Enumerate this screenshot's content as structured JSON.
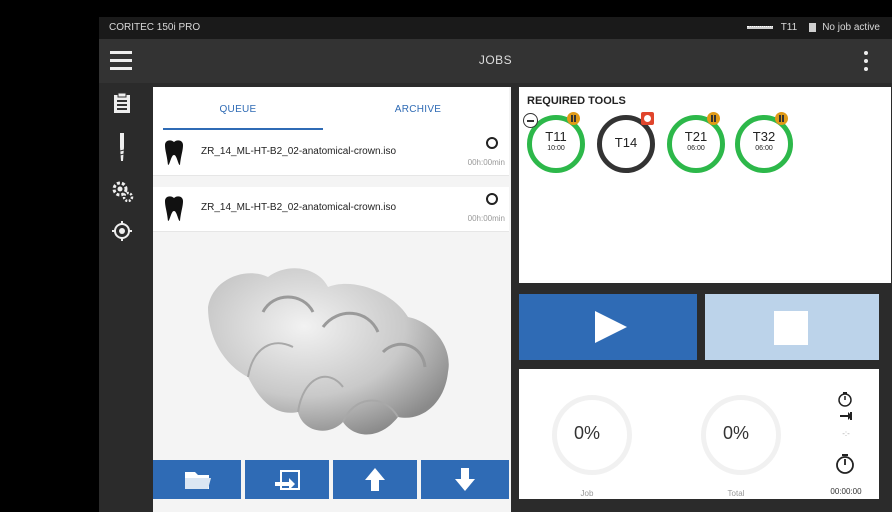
{
  "statusbar": {
    "device": "CORITEC 150i PRO",
    "tool": "T11",
    "job_status": "No job active"
  },
  "header": {
    "title": "JOBS"
  },
  "tabs": [
    {
      "label": "QUEUE",
      "active": true
    },
    {
      "label": "ARCHIVE",
      "active": false
    }
  ],
  "queue": [
    {
      "name": "ZR_14_ML-HT-B2_02-anatomical-crown.iso",
      "time": "00h:00min"
    },
    {
      "name": "ZR_14_ML-HT-B2_02-anatomical-crown.iso",
      "time": "00h:00min"
    }
  ],
  "tools_panel": {
    "title": "REQUIRED TOOLS",
    "tools": [
      {
        "id": "T11",
        "time": "10:00",
        "status": "ok"
      },
      {
        "id": "T14",
        "time": "",
        "status": "missing"
      },
      {
        "id": "T21",
        "time": "06:00",
        "status": "ok"
      },
      {
        "id": "T32",
        "time": "06:00",
        "status": "ok"
      }
    ]
  },
  "progress": {
    "job_value": "0%",
    "job_label": "Job",
    "total_value": "0%",
    "total_label": "Total",
    "timer": "00:00:00",
    "estimate": "-:-"
  },
  "colors": {
    "accent": "#2f6bb5",
    "tool_ok": "#2db84a",
    "tool_missing": "#333333",
    "warn": "#e09a18",
    "error": "#e0452c"
  }
}
